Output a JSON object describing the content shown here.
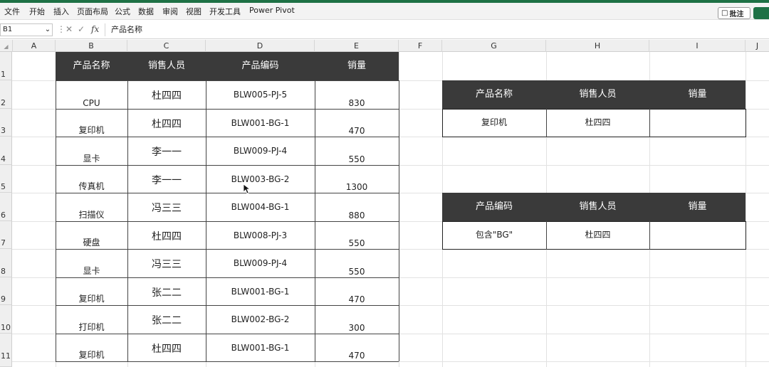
{
  "ribbon": {
    "tabs": [
      "文件",
      "开始",
      "插入",
      "页面布局",
      "公式",
      "数据",
      "审阅",
      "视图",
      "开发工具",
      "Power Pivot"
    ],
    "comment_label": "批注"
  },
  "formula_bar": {
    "name_box": "B1",
    "fx": "fx",
    "content": "产品名称"
  },
  "columns": [
    "A",
    "B",
    "C",
    "D",
    "E",
    "F",
    "G",
    "H",
    "I",
    "J"
  ],
  "rows": [
    "1",
    "2",
    "3",
    "4",
    "5",
    "6",
    "7",
    "8",
    "9",
    "10",
    "11"
  ],
  "main_table": {
    "headers": [
      "产品名称",
      "销售人员",
      "产品编码",
      "销量"
    ],
    "rows": [
      [
        "CPU",
        "杜四四",
        "BLW005-PJ-5",
        "830"
      ],
      [
        "复印机",
        "杜四四",
        "BLW001-BG-1",
        "470"
      ],
      [
        "显卡",
        "李一一",
        "BLW009-PJ-4",
        "550"
      ],
      [
        "传真机",
        "李一一",
        "BLW003-BG-2",
        "1300"
      ],
      [
        "扫描仪",
        "冯三三",
        "BLW004-BG-1",
        "880"
      ],
      [
        "硬盘",
        "杜四四",
        "BLW008-PJ-3",
        "550"
      ],
      [
        "显卡",
        "冯三三",
        "BLW009-PJ-4",
        "550"
      ],
      [
        "复印机",
        "张二二",
        "BLW001-BG-1",
        "470"
      ],
      [
        "打印机",
        "张二二",
        "BLW002-BG-2",
        "300"
      ],
      [
        "复印机",
        "杜四四",
        "BLW001-BG-1",
        "470"
      ]
    ]
  },
  "lookup_table_1": {
    "headers": [
      "产品名称",
      "销售人员",
      "销量"
    ],
    "row": [
      "复印机",
      "杜四四",
      ""
    ]
  },
  "lookup_table_2": {
    "headers": [
      "产品编码",
      "销售人员",
      "销量"
    ],
    "row": [
      "包含\"BG\"",
      "杜四四",
      ""
    ]
  },
  "colors": {
    "accent_green": "#1e7145",
    "header_dark": "#3a3a3a"
  }
}
